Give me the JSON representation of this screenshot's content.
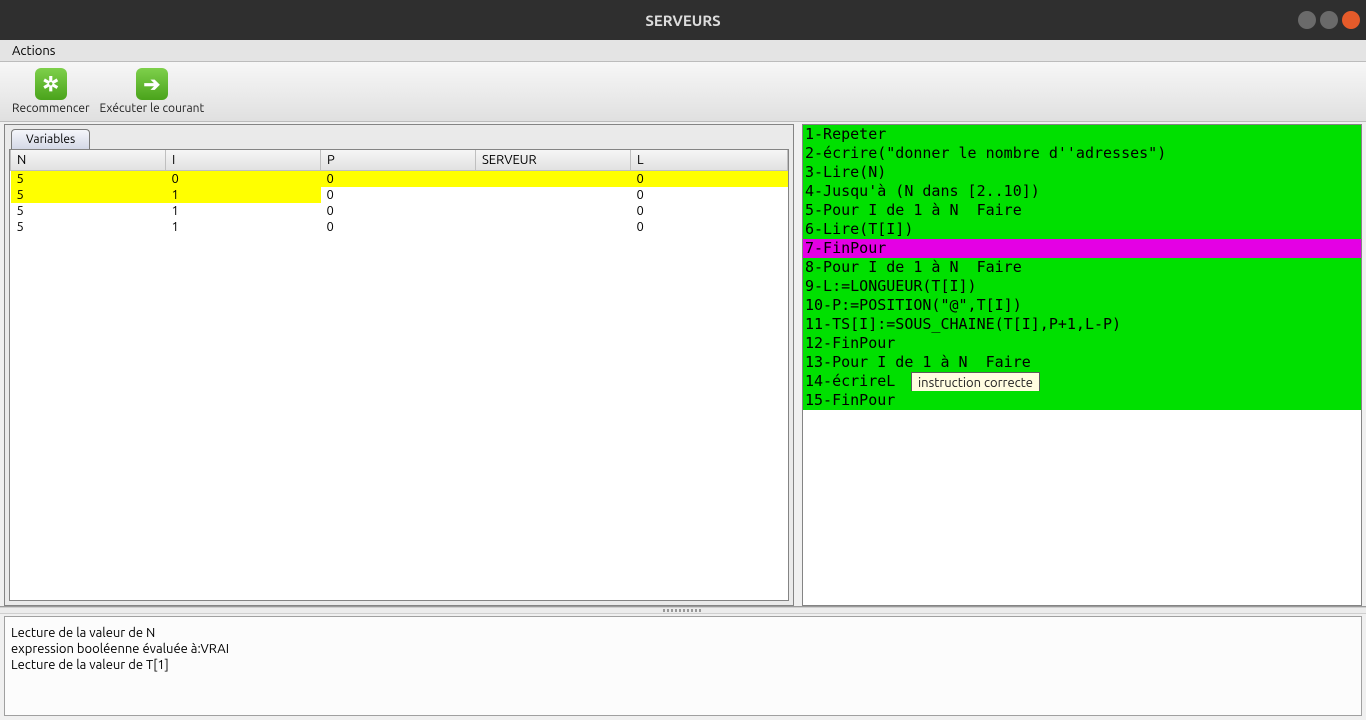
{
  "window": {
    "title": "SERVEURS"
  },
  "menu": {
    "actions": "Actions"
  },
  "toolbar": {
    "restart_label": "Recommencer",
    "run_label": "Exécuter le courant"
  },
  "tabs": {
    "variables": "Variables"
  },
  "table": {
    "columns": [
      "N",
      "I",
      "P",
      "SERVEUR",
      "L"
    ],
    "rows": [
      {
        "cells": [
          "5",
          "0",
          "0",
          "",
          "0"
        ],
        "hl": "full"
      },
      {
        "cells": [
          "5",
          "1",
          "0",
          "",
          "0"
        ],
        "hl": "partial"
      },
      {
        "cells": [
          "5",
          "1",
          "0",
          "",
          "0"
        ],
        "hl": "none"
      },
      {
        "cells": [
          "5",
          "1",
          "0",
          "",
          "0"
        ],
        "hl": "none"
      }
    ]
  },
  "code": {
    "lines": [
      {
        "text": "1-Repeter",
        "cls": "cl-green"
      },
      {
        "text": "2-écrire(\"donner le nombre d''adresses\")",
        "cls": "cl-green"
      },
      {
        "text": "3-Lire(N)",
        "cls": "cl-green"
      },
      {
        "text": "4-Jusqu'à (N dans [2..10])",
        "cls": "cl-green"
      },
      {
        "text": "5-Pour I de 1 à N  Faire",
        "cls": "cl-green"
      },
      {
        "text": "6-Lire(T[I])",
        "cls": "cl-green"
      },
      {
        "text": "7-FinPour",
        "cls": "cl-magenta"
      },
      {
        "text": "8-Pour I de 1 à N  Faire",
        "cls": "cl-green"
      },
      {
        "text": "9-L:=LONGUEUR(T[I])",
        "cls": "cl-green"
      },
      {
        "text": "10-P:=POSITION(\"@\",T[I])",
        "cls": "cl-green"
      },
      {
        "text": "11-TS[I]:=SOUS_CHAINE(T[I],P+1,L-P)",
        "cls": "cl-green"
      },
      {
        "text": "12-FinPour",
        "cls": "cl-green"
      },
      {
        "text": "13-Pour I de 1 à N  Faire",
        "cls": "cl-green"
      },
      {
        "text": "14-écrireL",
        "cls": "cl-green",
        "tooltip": "instruction correcte"
      },
      {
        "text": "15-FinPour",
        "cls": "cl-green"
      }
    ]
  },
  "console": {
    "lines": [
      "Lecture de la valeur de N",
      "expression booléenne évaluée à:VRAI",
      "Lecture de la valeur de T[1]"
    ]
  }
}
